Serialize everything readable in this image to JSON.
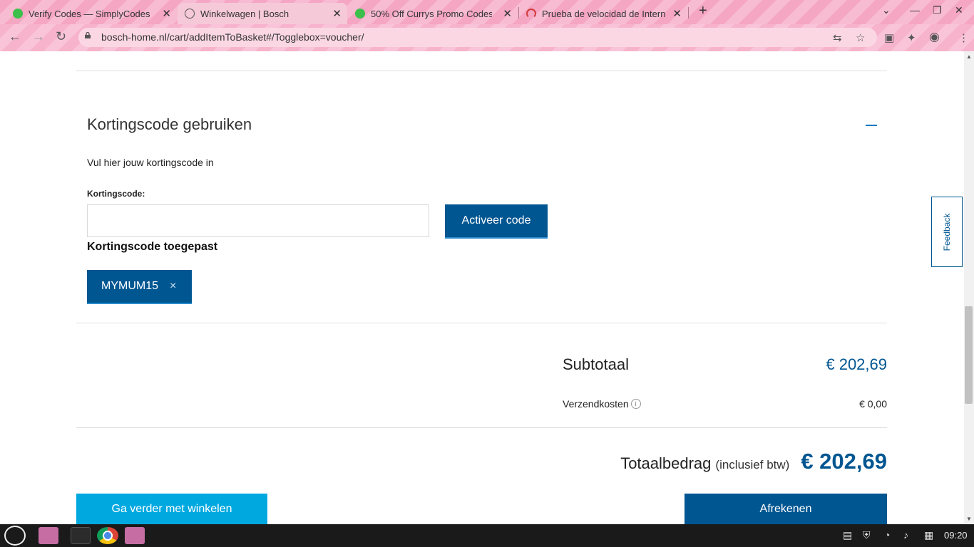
{
  "browser": {
    "tabs": [
      {
        "title": "Verify Codes — SimplyCodes",
        "favicon_color": "#3cbf4b"
      },
      {
        "title": "Winkelwagen | Bosch",
        "favicon_color": "#555555"
      },
      {
        "title": "50% Off Currys Promo Codes",
        "favicon_color": "#3cbf4b"
      },
      {
        "title": "Prueba de velocidad de Intern",
        "favicon_color": "#d23b3b"
      }
    ],
    "new_tab": "+",
    "url": "bosch-home.nl/cart/addItemToBasket#/Togglebox=voucher/"
  },
  "voucher": {
    "section_title": "Kortingscode gebruiken",
    "intro": "Vul hier jouw kortingscode in",
    "field_label": "Kortingscode:",
    "input_value": "",
    "activate_button": "Activeer code",
    "applied_title": "Kortingscode toegepast",
    "applied_code": "MYMUM15",
    "remove_icon": "×"
  },
  "summary": {
    "subtotal_label": "Subtotaal",
    "subtotal_value": "€ 202,69",
    "shipping_label": "Verzendkosten",
    "shipping_value": "€ 0,00",
    "total_label": "Totaalbedrag",
    "total_note": "(inclusief btw)",
    "total_value": "€ 202,69"
  },
  "buttons": {
    "continue_shopping": "Ga verder met winkelen",
    "checkout": "Afrekenen"
  },
  "feedback_tab": "Feedback",
  "taskbar": {
    "clock": "09:20"
  },
  "colors": {
    "brand_dark_blue": "#005691",
    "brand_light_blue": "#00a8e0"
  }
}
